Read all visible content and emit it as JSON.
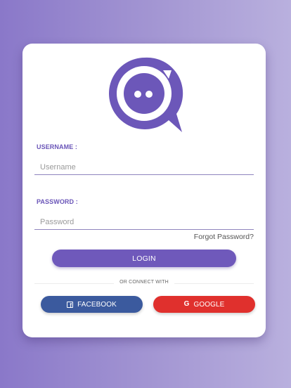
{
  "colors": {
    "brand_purple": "#6f59bb",
    "facebook_blue": "#3b5a9e",
    "google_red": "#e0302d"
  },
  "logo": {
    "icon": "chat-bubble-face-icon"
  },
  "username": {
    "label": "USERNAME :",
    "placeholder": "Username",
    "value": ""
  },
  "password": {
    "label": "PASSWORD :",
    "placeholder": "Password",
    "value": ""
  },
  "forgot_password": "Forgot Password?",
  "login_button": "LOGIN",
  "divider_text": "OR CONNECT WITH",
  "social": {
    "facebook": {
      "label": "FACEBOOK",
      "icon": "facebook-icon"
    },
    "google": {
      "label": "GOOGLE",
      "icon": "google-icon"
    }
  }
}
